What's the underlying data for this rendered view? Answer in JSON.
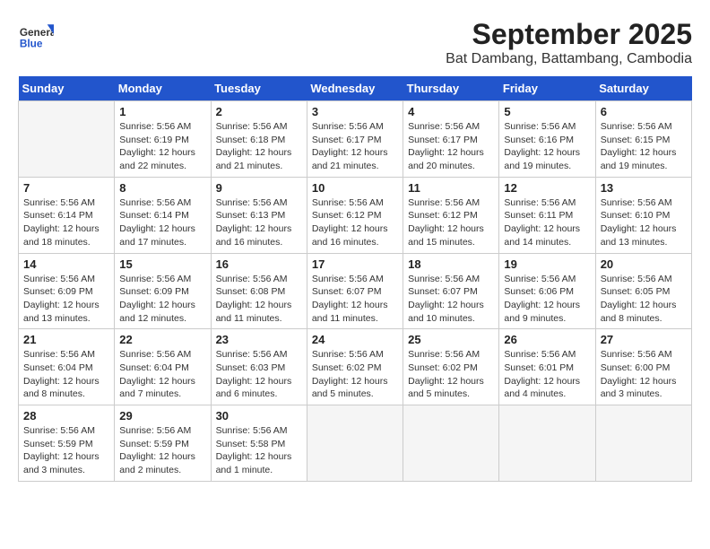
{
  "header": {
    "logo_general": "General",
    "logo_blue": "Blue",
    "month": "September 2025",
    "location": "Bat Dambang, Battambang, Cambodia"
  },
  "weekdays": [
    "Sunday",
    "Monday",
    "Tuesday",
    "Wednesday",
    "Thursday",
    "Friday",
    "Saturday"
  ],
  "weeks": [
    [
      {
        "day": "",
        "info": ""
      },
      {
        "day": "1",
        "info": "Sunrise: 5:56 AM\nSunset: 6:19 PM\nDaylight: 12 hours\nand 22 minutes."
      },
      {
        "day": "2",
        "info": "Sunrise: 5:56 AM\nSunset: 6:18 PM\nDaylight: 12 hours\nand 21 minutes."
      },
      {
        "day": "3",
        "info": "Sunrise: 5:56 AM\nSunset: 6:17 PM\nDaylight: 12 hours\nand 21 minutes."
      },
      {
        "day": "4",
        "info": "Sunrise: 5:56 AM\nSunset: 6:17 PM\nDaylight: 12 hours\nand 20 minutes."
      },
      {
        "day": "5",
        "info": "Sunrise: 5:56 AM\nSunset: 6:16 PM\nDaylight: 12 hours\nand 19 minutes."
      },
      {
        "day": "6",
        "info": "Sunrise: 5:56 AM\nSunset: 6:15 PM\nDaylight: 12 hours\nand 19 minutes."
      }
    ],
    [
      {
        "day": "7",
        "info": "Sunrise: 5:56 AM\nSunset: 6:14 PM\nDaylight: 12 hours\nand 18 minutes."
      },
      {
        "day": "8",
        "info": "Sunrise: 5:56 AM\nSunset: 6:14 PM\nDaylight: 12 hours\nand 17 minutes."
      },
      {
        "day": "9",
        "info": "Sunrise: 5:56 AM\nSunset: 6:13 PM\nDaylight: 12 hours\nand 16 minutes."
      },
      {
        "day": "10",
        "info": "Sunrise: 5:56 AM\nSunset: 6:12 PM\nDaylight: 12 hours\nand 16 minutes."
      },
      {
        "day": "11",
        "info": "Sunrise: 5:56 AM\nSunset: 6:12 PM\nDaylight: 12 hours\nand 15 minutes."
      },
      {
        "day": "12",
        "info": "Sunrise: 5:56 AM\nSunset: 6:11 PM\nDaylight: 12 hours\nand 14 minutes."
      },
      {
        "day": "13",
        "info": "Sunrise: 5:56 AM\nSunset: 6:10 PM\nDaylight: 12 hours\nand 13 minutes."
      }
    ],
    [
      {
        "day": "14",
        "info": "Sunrise: 5:56 AM\nSunset: 6:09 PM\nDaylight: 12 hours\nand 13 minutes."
      },
      {
        "day": "15",
        "info": "Sunrise: 5:56 AM\nSunset: 6:09 PM\nDaylight: 12 hours\nand 12 minutes."
      },
      {
        "day": "16",
        "info": "Sunrise: 5:56 AM\nSunset: 6:08 PM\nDaylight: 12 hours\nand 11 minutes."
      },
      {
        "day": "17",
        "info": "Sunrise: 5:56 AM\nSunset: 6:07 PM\nDaylight: 12 hours\nand 11 minutes."
      },
      {
        "day": "18",
        "info": "Sunrise: 5:56 AM\nSunset: 6:07 PM\nDaylight: 12 hours\nand 10 minutes."
      },
      {
        "day": "19",
        "info": "Sunrise: 5:56 AM\nSunset: 6:06 PM\nDaylight: 12 hours\nand 9 minutes."
      },
      {
        "day": "20",
        "info": "Sunrise: 5:56 AM\nSunset: 6:05 PM\nDaylight: 12 hours\nand 8 minutes."
      }
    ],
    [
      {
        "day": "21",
        "info": "Sunrise: 5:56 AM\nSunset: 6:04 PM\nDaylight: 12 hours\nand 8 minutes."
      },
      {
        "day": "22",
        "info": "Sunrise: 5:56 AM\nSunset: 6:04 PM\nDaylight: 12 hours\nand 7 minutes."
      },
      {
        "day": "23",
        "info": "Sunrise: 5:56 AM\nSunset: 6:03 PM\nDaylight: 12 hours\nand 6 minutes."
      },
      {
        "day": "24",
        "info": "Sunrise: 5:56 AM\nSunset: 6:02 PM\nDaylight: 12 hours\nand 5 minutes."
      },
      {
        "day": "25",
        "info": "Sunrise: 5:56 AM\nSunset: 6:02 PM\nDaylight: 12 hours\nand 5 minutes."
      },
      {
        "day": "26",
        "info": "Sunrise: 5:56 AM\nSunset: 6:01 PM\nDaylight: 12 hours\nand 4 minutes."
      },
      {
        "day": "27",
        "info": "Sunrise: 5:56 AM\nSunset: 6:00 PM\nDaylight: 12 hours\nand 3 minutes."
      }
    ],
    [
      {
        "day": "28",
        "info": "Sunrise: 5:56 AM\nSunset: 5:59 PM\nDaylight: 12 hours\nand 3 minutes."
      },
      {
        "day": "29",
        "info": "Sunrise: 5:56 AM\nSunset: 5:59 PM\nDaylight: 12 hours\nand 2 minutes."
      },
      {
        "day": "30",
        "info": "Sunrise: 5:56 AM\nSunset: 5:58 PM\nDaylight: 12 hours\nand 1 minute."
      },
      {
        "day": "",
        "info": ""
      },
      {
        "day": "",
        "info": ""
      },
      {
        "day": "",
        "info": ""
      },
      {
        "day": "",
        "info": ""
      }
    ]
  ]
}
